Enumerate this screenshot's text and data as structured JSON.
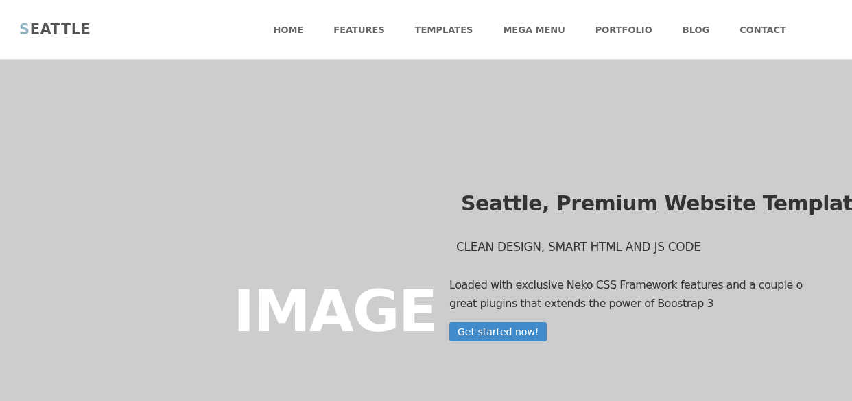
{
  "header": {
    "logo": "SEATTLE",
    "nav": [
      {
        "label": "HOME"
      },
      {
        "label": "FEATURES"
      },
      {
        "label": "TEMPLATES"
      },
      {
        "label": "MEGA MENU"
      },
      {
        "label": "PORTFOLIO"
      },
      {
        "label": "BLOG"
      },
      {
        "label": "CONTACT"
      }
    ]
  },
  "hero": {
    "placeholder_label": "IMAGE",
    "title": "Seattle, Premium Website Templat",
    "subtitle": "CLEAN DESIGN, SMART HTML AND JS CODE",
    "description": "Loaded with exclusive Neko CSS Framework features and a couple o\ngreat plugins that extends the power of Boostrap 3",
    "button": "Get started now!"
  }
}
